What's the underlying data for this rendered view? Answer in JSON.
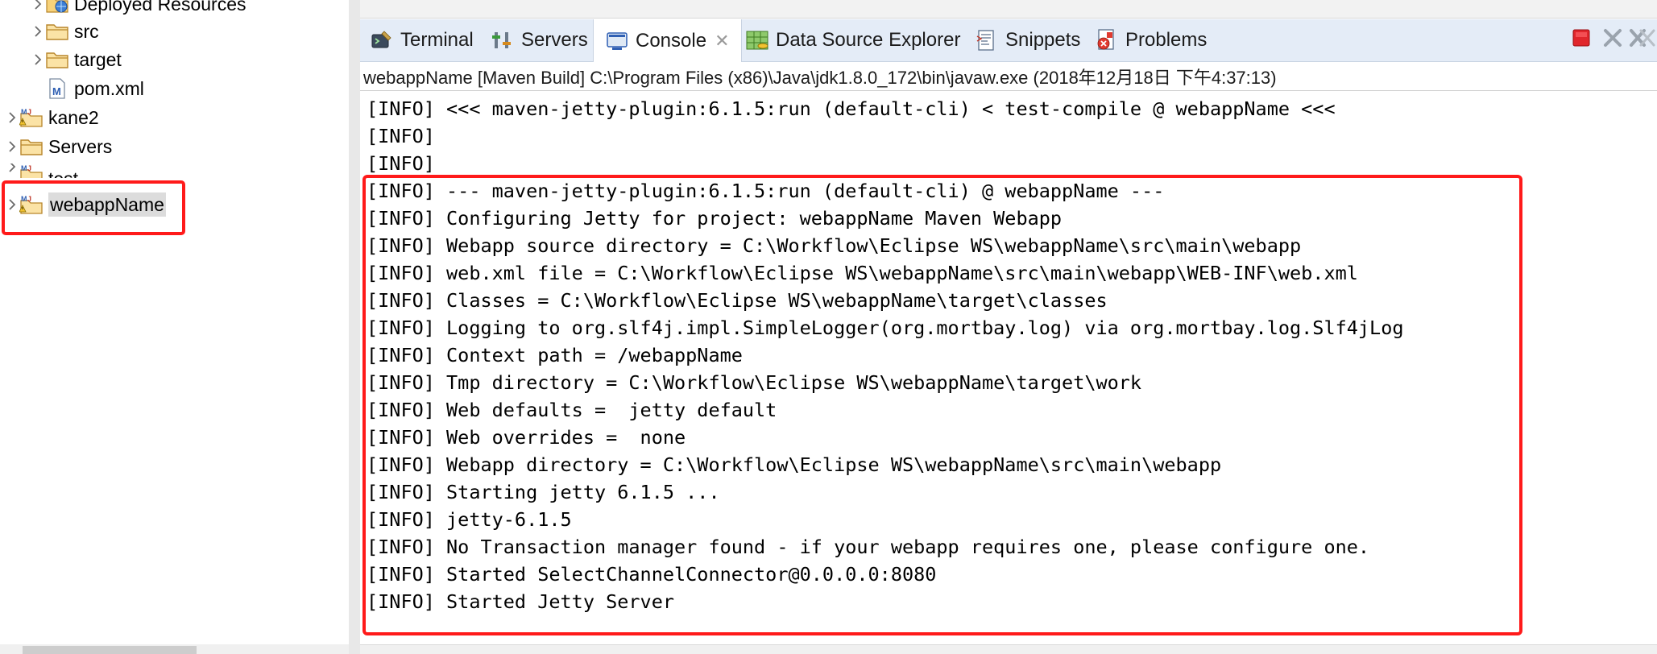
{
  "explorer": {
    "items": [
      {
        "label": "Deployed Resources",
        "icon": "deployed-resources-icon",
        "expanded": false
      },
      {
        "label": "src",
        "icon": "folder-icon",
        "expanded": false
      },
      {
        "label": "target",
        "icon": "folder-icon",
        "expanded": false
      },
      {
        "label": "pom.xml",
        "icon": "maven-pom-file-icon"
      },
      {
        "label": "kane2",
        "icon": "maven-project-icon",
        "expanded": false
      },
      {
        "label": "Servers",
        "icon": "folder-icon",
        "expanded": false
      },
      {
        "label": "test",
        "icon": "maven-project-icon",
        "expanded": false
      },
      {
        "label": "webappName",
        "icon": "maven-project-icon",
        "expanded": false,
        "selected": true
      }
    ]
  },
  "tabs": [
    {
      "label": "Terminal",
      "icon": "terminal-icon"
    },
    {
      "label": "Servers",
      "icon": "servers-icon"
    },
    {
      "label": "Console",
      "icon": "console-icon",
      "active": true,
      "close_icon": "close-icon"
    },
    {
      "label": "Data Source Explorer",
      "icon": "data-source-icon"
    },
    {
      "label": "Snippets",
      "icon": "snippets-icon"
    },
    {
      "label": "Problems",
      "icon": "problems-icon"
    }
  ],
  "toolbar": {
    "icons": [
      "terminate-icon",
      "remove-launch-icon",
      "remove-all-terminated-icon"
    ]
  },
  "console": {
    "launch_info": "webappName [Maven Build] C:\\Program Files (x86)\\Java\\jdk1.8.0_172\\bin\\javaw.exe (2018年12月18日 下午4:37:13)",
    "lines": [
      "[INFO] <<< maven-jetty-plugin:6.1.5:run (default-cli) < test-compile @ webappName <<<",
      "[INFO]",
      "[INFO]",
      "[INFO] --- maven-jetty-plugin:6.1.5:run (default-cli) @ webappName ---",
      "[INFO] Configuring Jetty for project: webappName Maven Webapp",
      "[INFO] Webapp source directory = C:\\Workflow\\Eclipse WS\\webappName\\src\\main\\webapp",
      "[INFO] web.xml file = C:\\Workflow\\Eclipse WS\\webappName\\src\\main\\webapp\\WEB-INF\\web.xml",
      "[INFO] Classes = C:\\Workflow\\Eclipse WS\\webappName\\target\\classes",
      "[INFO] Logging to org.slf4j.impl.SimpleLogger(org.mortbay.log) via org.mortbay.log.Slf4jLog",
      "[INFO] Context path = /webappName",
      "[INFO] Tmp directory = C:\\Workflow\\Eclipse WS\\webappName\\target\\work",
      "[INFO] Web defaults =  jetty default",
      "[INFO] Web overrides =  none",
      "[INFO] Webapp directory = C:\\Workflow\\Eclipse WS\\webappName\\src\\main\\webapp",
      "[INFO] Starting jetty 6.1.5 ...",
      "[INFO] jetty-6.1.5",
      "[INFO] No Transaction manager found - if your webapp requires one, please configure one.",
      "[INFO] Started SelectChannelConnector@0.0.0.0:8080",
      "[INFO] Started Jetty Server"
    ]
  },
  "colors": {
    "highlight": "#ff1a1a",
    "tabbar_bg": "#e4ecf7"
  }
}
